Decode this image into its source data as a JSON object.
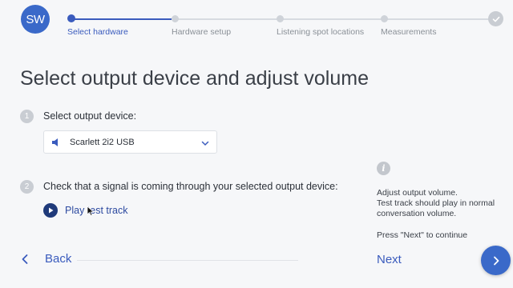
{
  "app": {
    "logo_text": "SW"
  },
  "stepper": {
    "steps": [
      {
        "label": "Select hardware",
        "state": "active"
      },
      {
        "label": "Hardware setup",
        "state": "pending"
      },
      {
        "label": "Listening spot locations",
        "state": "pending"
      },
      {
        "label": "Measurements",
        "state": "pending"
      }
    ],
    "final_icon": "check-icon"
  },
  "main": {
    "title": "Select output device and adjust volume",
    "step1": {
      "number": "1",
      "label": "Select output device:",
      "device_select": {
        "value": "Scarlett 2i2 USB",
        "icon": "speaker-icon"
      }
    },
    "step2": {
      "number": "2",
      "label": "Check that a signal is coming through your selected output device:",
      "play_label": "Play test track"
    }
  },
  "help": {
    "icon": "info-icon",
    "icon_text": "i",
    "line1": "Adjust output volume.",
    "line2": "Test track should play in normal",
    "line3": "conversation volume.",
    "line4": "Press \"Next\" to continue"
  },
  "footer": {
    "back_label": "Back",
    "next_label": "Next"
  },
  "colors": {
    "accent": "#3a69c9",
    "link": "#3a5bbd",
    "muted": "#c9cdd3"
  }
}
